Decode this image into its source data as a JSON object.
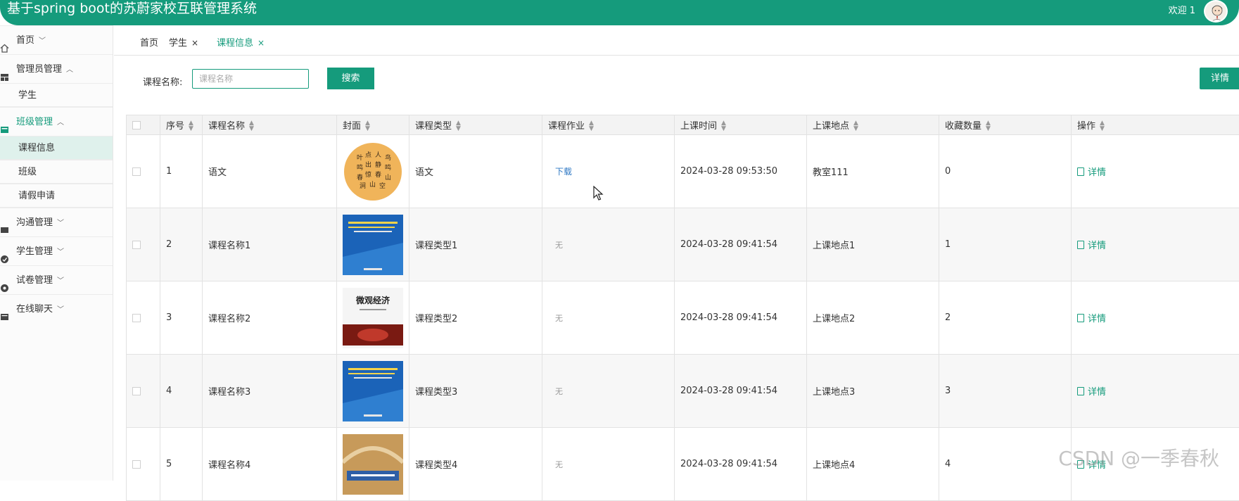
{
  "header": {
    "title": "基于spring boot的苏蔚家校互联管理系统",
    "welcome": "欢迎 1"
  },
  "sidebar": {
    "items": [
      {
        "label": "首页",
        "chevron": "﹀",
        "icon": "home-icon"
      },
      {
        "label": "管理员管理",
        "chevron": "︿",
        "icon": "admin-icon"
      },
      {
        "label": "学生",
        "sub": true
      },
      {
        "label": "班级管理",
        "chevron": "︿",
        "icon": "class-icon",
        "active": true
      },
      {
        "label": "课程信息",
        "sub": true,
        "active": true
      },
      {
        "label": "班级",
        "sub": true
      },
      {
        "label": "请假申请",
        "sub": true
      },
      {
        "label": "沟通管理",
        "chevron": "﹀",
        "icon": "chat-icon"
      },
      {
        "label": "学生管理",
        "chevron": "﹀",
        "icon": "student-icon"
      },
      {
        "label": "试卷管理",
        "chevron": "﹀",
        "icon": "exam-icon"
      },
      {
        "label": "在线聊天",
        "chevron": "﹀",
        "icon": "message-icon"
      }
    ]
  },
  "tabs": [
    {
      "label": "首页"
    },
    {
      "label": "学生",
      "closable": "×"
    },
    {
      "label": "课程信息",
      "closable": "×",
      "active": true
    }
  ],
  "search": {
    "label": "课程名称:",
    "placeholder": "课程名称",
    "button": "搜索",
    "detail_button": "详情"
  },
  "table": {
    "headers": [
      "序号",
      "课程名称",
      "封面",
      "课程类型",
      "课程作业",
      "上课时间",
      "上课地点",
      "收藏数量",
      "操作"
    ],
    "rows": [
      {
        "no": "1",
        "name": "语文",
        "cover": "calligraphy",
        "type": "语文",
        "homework": "下载",
        "time": "2024-03-28 09:53:50",
        "place": "教室111",
        "fav": "0",
        "op": "详情"
      },
      {
        "no": "2",
        "name": "课程名称1",
        "cover": "blue-book",
        "type": "课程类型1",
        "homework": "无",
        "time": "2024-03-28 09:41:54",
        "place": "上课地点1",
        "fav": "1",
        "op": "详情"
      },
      {
        "no": "3",
        "name": "课程名称2",
        "cover": "red-book",
        "type": "课程类型2",
        "homework": "无",
        "time": "2024-03-28 09:41:54",
        "place": "上课地点2",
        "fav": "2",
        "op": "详情"
      },
      {
        "no": "4",
        "name": "课程名称3",
        "cover": "blue-book",
        "type": "课程类型3",
        "homework": "无",
        "time": "2024-03-28 09:41:54",
        "place": "上课地点3",
        "fav": "3",
        "op": "详情"
      },
      {
        "no": "5",
        "name": "课程名称4",
        "cover": "brown-book",
        "type": "课程类型4",
        "homework": "无",
        "time": "2024-03-28 09:41:54",
        "place": "上课地点4",
        "fav": "4",
        "op": "详情"
      }
    ]
  },
  "watermark": "CSDN @一季春秋",
  "colors": {
    "accent": "#159b7c",
    "link": "#2f78c4"
  }
}
